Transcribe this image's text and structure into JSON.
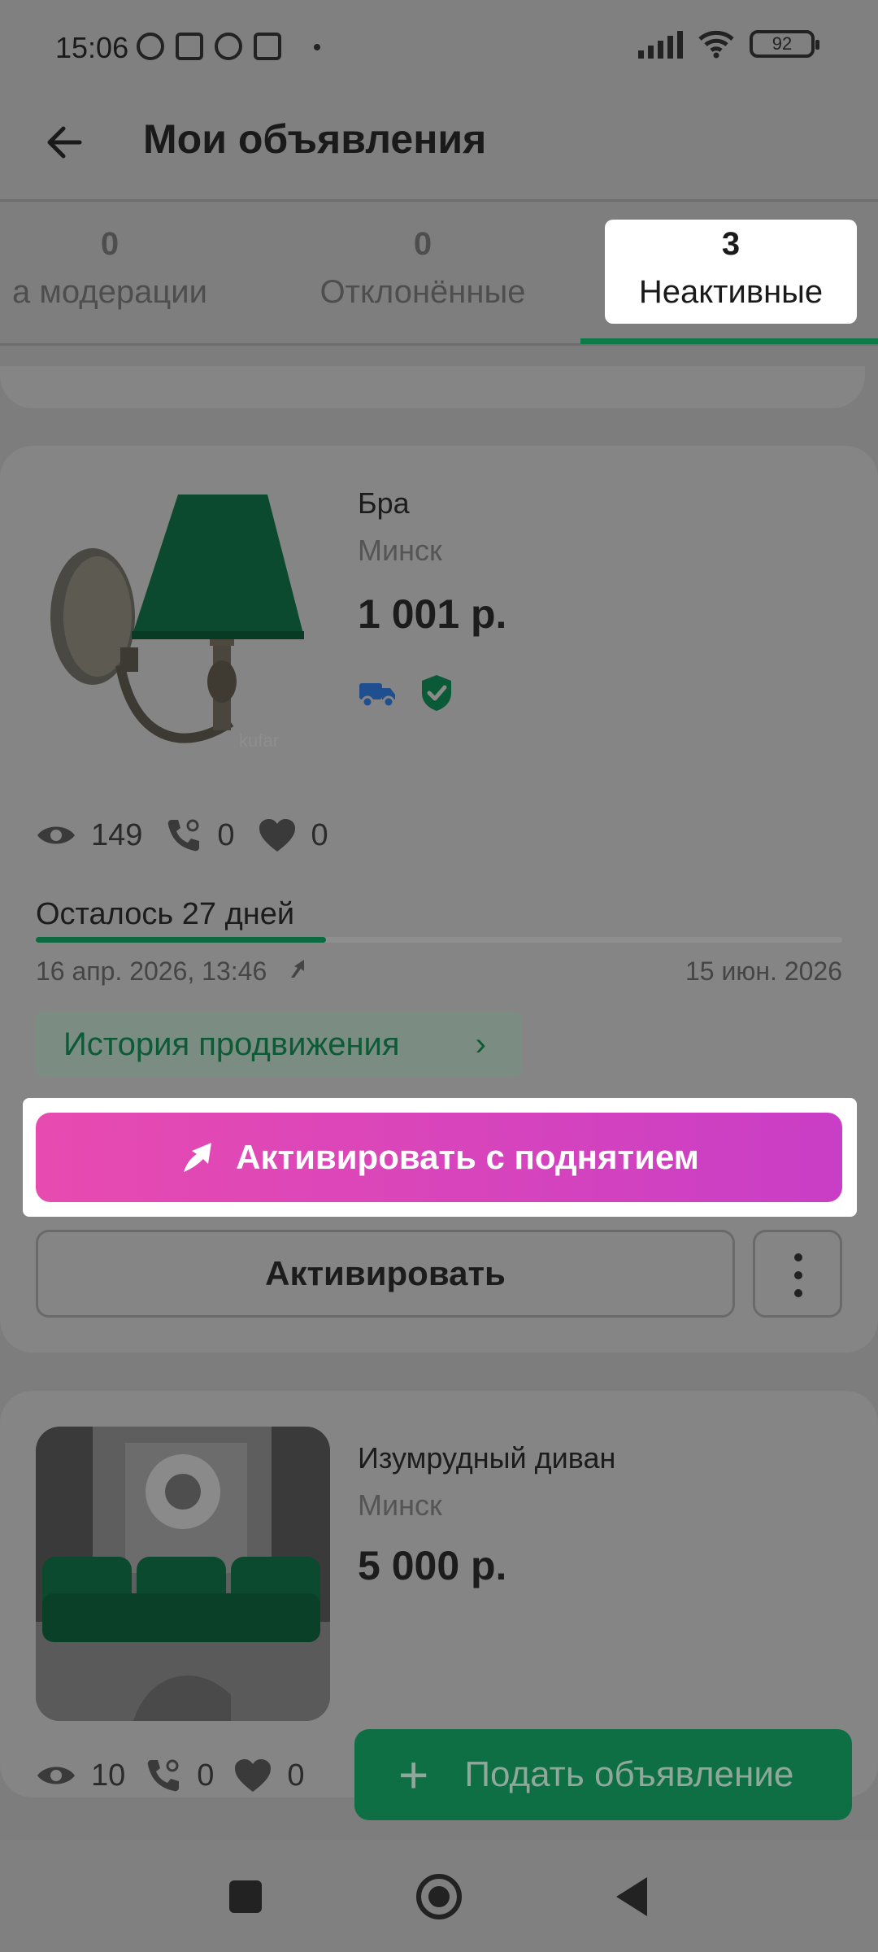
{
  "status_bar": {
    "time": "15:06",
    "battery": "92"
  },
  "header": {
    "title": "Мои объявления"
  },
  "tabs": [
    {
      "count": "0",
      "label": "а модерации"
    },
    {
      "count": "0",
      "label": "Отклонённые"
    },
    {
      "count": "3",
      "label": "Неактивные",
      "selected": true
    }
  ],
  "listings": [
    {
      "title": "Бра",
      "city": "Минск",
      "price": "1 001 р.",
      "views": "149",
      "calls": "0",
      "likes": "0",
      "remaining": "Осталось 27 дней",
      "remaining_fraction": 0.36,
      "date_start": "16 апр. 2026, 13:46",
      "date_end": "15 июн. 2026",
      "history_label": "История продвижения",
      "boost_button": "Активировать с поднятием",
      "activate_button": "Активировать"
    },
    {
      "title": "Изумрудный диван",
      "city": "Минск",
      "price": "5 000 р.",
      "views": "10",
      "calls": "0",
      "likes": "0"
    }
  ],
  "fab": {
    "label": "Подать объявление"
  },
  "colors": {
    "accent_green": "#0e7a4a",
    "boost_gradient_start": "#e84bb0",
    "boost_gradient_end": "#c93ec6"
  }
}
